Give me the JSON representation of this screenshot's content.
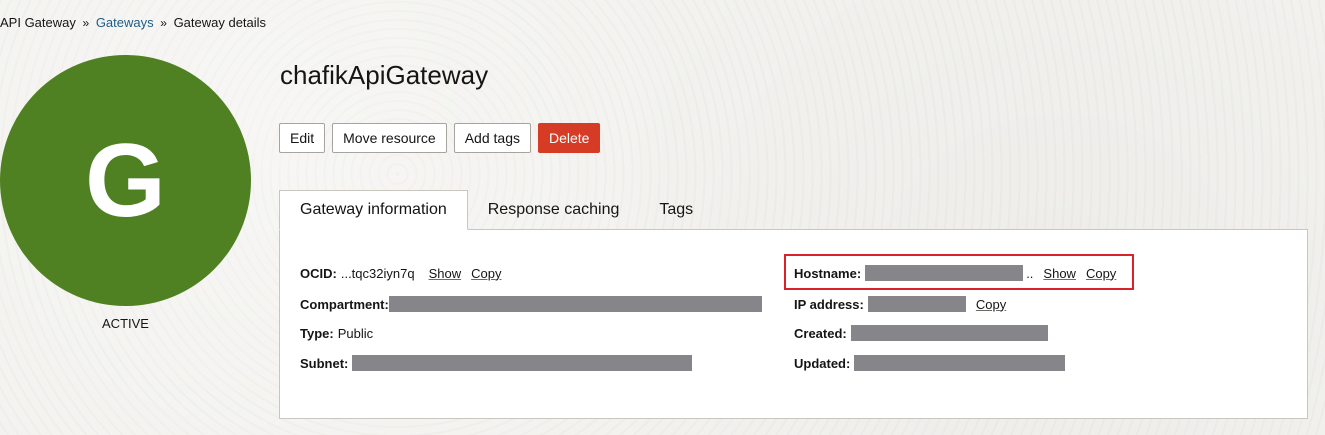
{
  "breadcrumb": {
    "root": "API Gateway",
    "gateways": "Gateways",
    "current": "Gateway details",
    "separator": "»"
  },
  "resource": {
    "avatar_letter": "G",
    "status": "ACTIVE",
    "title": "chafikApiGateway"
  },
  "actions": {
    "edit": "Edit",
    "move": "Move resource",
    "add_tags": "Add tags",
    "delete": "Delete"
  },
  "tabs": [
    {
      "label": "Gateway information",
      "active": true
    },
    {
      "label": "Response caching",
      "active": false
    },
    {
      "label": "Tags",
      "active": false
    }
  ],
  "info": {
    "ocid_label": "OCID:",
    "ocid_value": "...tqc32iyn7q",
    "show_label": "Show",
    "copy_label": "Copy",
    "compartment_label": "Compartment:",
    "type_label": "Type:",
    "type_value": "Public",
    "subnet_label": "Subnet:",
    "hostname_label": "Hostname:",
    "hostname_ellipsis": "..",
    "ip_label": "IP address:",
    "created_label": "Created:",
    "updated_label": "Updated:"
  },
  "colors": {
    "avatar": "#4f8123",
    "delete_button": "#d63b25",
    "highlight": "#d8232a",
    "link": "#1d5d8a",
    "redaction": "#86868a"
  }
}
